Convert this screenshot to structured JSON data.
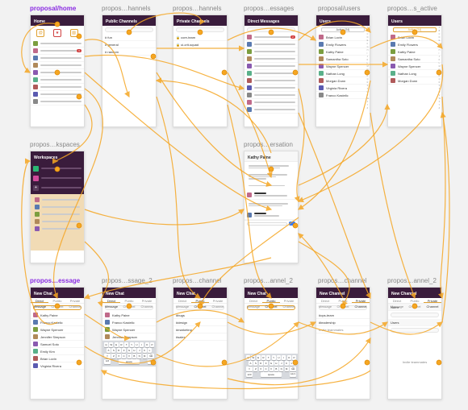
{
  "labels": {
    "r1": [
      "proposal/home",
      "propos…hannels",
      "propos…hannels",
      "propos…essages",
      "proposal/users",
      "propos…s_active"
    ],
    "r2": [
      "propos…kspaces",
      "propos…ersation"
    ],
    "r3": [
      "propos…essage",
      "propos…ssage_2",
      "propos…channel",
      "propos…annel_2",
      "propos…channel",
      "propos…annel_2"
    ]
  },
  "home": {
    "header": "Home",
    "badge": "3"
  },
  "public_channels": {
    "header": "Public Channels",
    "items": [
      "fun",
      "general",
      "random"
    ]
  },
  "private_channels": {
    "header": "Private Channels",
    "items": [
      "core-team",
      "ui-crit-squad"
    ]
  },
  "dms": {
    "header": "Direct Messages"
  },
  "users": {
    "header": "Users",
    "filter_active": "Active (24)",
    "filter_active_on": "Active (24)",
    "list": [
      "Brian Lovin",
      "Emily Flowers",
      "Kathy Paine",
      "Samantha Soto",
      "Wayne Spencer",
      "Nathan Long",
      "Morgan Dunn",
      "Virginia Rivera",
      "Franco Kastelic"
    ]
  },
  "workspaces": {
    "header": "Workspaces"
  },
  "conversation": {
    "title": "Kathy Paine"
  },
  "new_chat": {
    "header": "New Chat",
    "tabs": [
      "Direct Message",
      "Public Channel",
      "Private Channel"
    ]
  },
  "new_channel": {
    "header": "New Channel",
    "public": [
      "#bugs",
      "#design",
      "#marketing",
      "#sales"
    ],
    "private": [
      "#ops-team",
      "#leadership"
    ],
    "invite_label": "Invite teammates",
    "form": {
      "name": "Name",
      "users": "Users"
    }
  },
  "contacts": [
    "Kathy Paine",
    "Franco Kastelic",
    "Wayne Spencer",
    "Jennifer Simpson",
    "Samuel Soto",
    "Emily Kim",
    "Brian Lovin",
    "Virginia Rivera"
  ],
  "keyboard": {
    "space": "space",
    "return": "return",
    "space_label": "123"
  },
  "colors": {
    "accent": "#f5a623",
    "brand_dark": "#3a1c3c",
    "selection": "#8a2be2"
  }
}
